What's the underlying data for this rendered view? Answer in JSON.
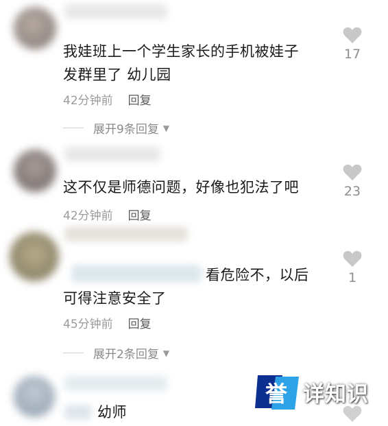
{
  "comments": [
    {
      "text_line1": "我娃班上一个学生家长的手机被娃子",
      "text_line2": "发群里了 幼儿园",
      "time": "42分钟前",
      "reply": "回复",
      "expand": "展开9条回复",
      "likes": "17"
    },
    {
      "text_line1": "这不仅是师德问题，好像也犯法了吧",
      "time": "42分钟前",
      "reply": "回复",
      "likes": "23"
    },
    {
      "text_line1": "看危险不，以后",
      "text_line2": "可得注意安全了",
      "time": "45分钟前",
      "reply": "回复",
      "expand": "展开2条回复",
      "likes": "1"
    },
    {
      "text_line1": "幼师"
    }
  ],
  "watermark": {
    "glyph": "誉",
    "text": "详知识",
    "colors": {
      "mark_dark": "#0d2f8f",
      "mark_light": "#2ea2e6"
    }
  },
  "icons": {
    "like": "heart-icon",
    "caret": "caret-down-icon"
  },
  "colors": {
    "meta": "#9a9a9a",
    "heart": "#c8c8c8"
  }
}
